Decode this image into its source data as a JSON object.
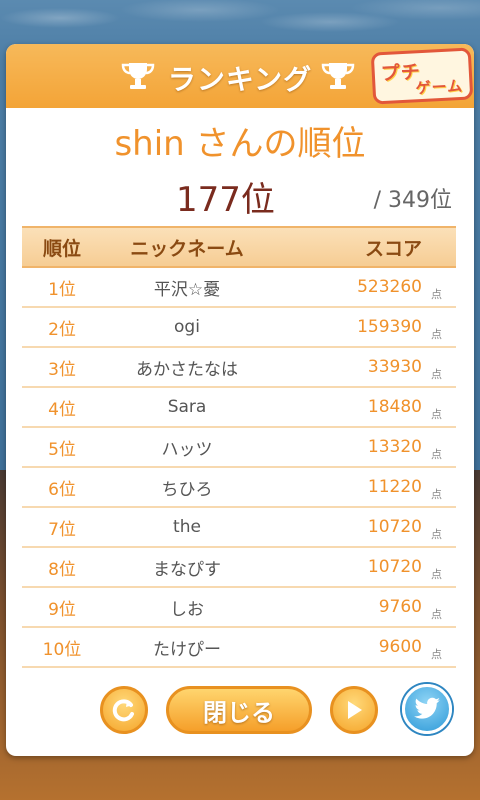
{
  "header": {
    "title": "ランキング",
    "logo_line1": "プチ",
    "logo_line2": "ゲーム"
  },
  "page_title": "shin さんの順位",
  "my_rank": "177位",
  "total": "/ 349位",
  "table": {
    "headers": {
      "rank": "順位",
      "name": "ニックネーム",
      "score": "スコア"
    },
    "unit": "点",
    "rows": [
      {
        "rank": "1位",
        "name": "平沢☆憂",
        "score": "523260"
      },
      {
        "rank": "2位",
        "name": "ogi",
        "score": "159390"
      },
      {
        "rank": "3位",
        "name": "あかさたなは",
        "score": "33930"
      },
      {
        "rank": "4位",
        "name": "Sara",
        "score": "18480"
      },
      {
        "rank": "5位",
        "name": "ハッツ",
        "score": "13320"
      },
      {
        "rank": "6位",
        "name": "ちひろ",
        "score": "11220"
      },
      {
        "rank": "7位",
        "name": "the",
        "score": "10720"
      },
      {
        "rank": "8位",
        "name": "まなぴす",
        "score": "10720"
      },
      {
        "rank": "9位",
        "name": "しお",
        "score": "9760"
      },
      {
        "rank": "10位",
        "name": "たけぴー",
        "score": "9600"
      }
    ]
  },
  "buttons": {
    "close_label": "閉じる"
  },
  "icons": {
    "trophy": "trophy-icon",
    "refresh": "refresh-icon",
    "next": "play-icon",
    "twitter": "twitter-bird-icon"
  },
  "colors": {
    "accent": "#f0922c",
    "header": "#f3a437",
    "rank_highlight": "#7a2b1e",
    "twitter": "#2e9ad8"
  }
}
